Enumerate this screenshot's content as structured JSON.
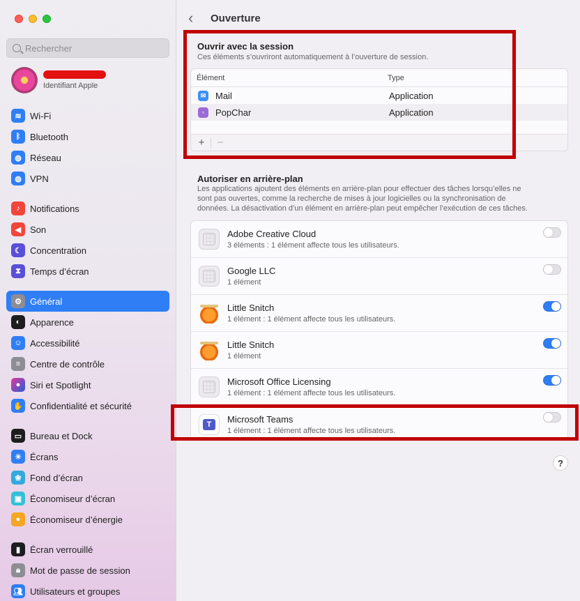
{
  "colors": {
    "accent": "#2f7ef5",
    "highlight": "#c00000"
  },
  "sidebar": {
    "search_placeholder": "Rechercher",
    "account_sub": "Identifiant Apple",
    "items": [
      {
        "label": "Wi-Fi",
        "icon": "wifi-icon"
      },
      {
        "label": "Bluetooth",
        "icon": "bluetooth-icon"
      },
      {
        "label": "Réseau",
        "icon": "globe-icon"
      },
      {
        "label": "VPN",
        "icon": "vpn-icon"
      },
      {
        "label": "Notifications",
        "icon": "bell-icon"
      },
      {
        "label": "Son",
        "icon": "speaker-icon"
      },
      {
        "label": "Concentration",
        "icon": "moon-icon"
      },
      {
        "label": "Temps d’écran",
        "icon": "hourglass-icon"
      },
      {
        "label": "Général",
        "icon": "gear-icon"
      },
      {
        "label": "Apparence",
        "icon": "appearance-icon"
      },
      {
        "label": "Accessibilité",
        "icon": "accessibility-icon"
      },
      {
        "label": "Centre de contrôle",
        "icon": "control-center-icon"
      },
      {
        "label": "Siri et Spotlight",
        "icon": "siri-icon"
      },
      {
        "label": "Confidentialité et sécurité",
        "icon": "hand-icon"
      },
      {
        "label": "Bureau et Dock",
        "icon": "dock-icon"
      },
      {
        "label": "Écrans",
        "icon": "display-icon"
      },
      {
        "label": "Fond d’écran",
        "icon": "wallpaper-icon"
      },
      {
        "label": "Économiseur d’écran",
        "icon": "screensaver-icon"
      },
      {
        "label": "Économiseur d’énergie",
        "icon": "energy-icon"
      },
      {
        "label": "Écran verrouillé",
        "icon": "lock-icon"
      },
      {
        "label": "Mot de passe de session",
        "icon": "password-icon"
      },
      {
        "label": "Utilisateurs et groupes",
        "icon": "users-icon"
      }
    ]
  },
  "main": {
    "title": "Ouverture",
    "session": {
      "title": "Ouvrir avec la session",
      "desc": "Ces éléments s’ouvriront automatiquement à l’ouverture de session.",
      "col_element": "Élément",
      "col_type": "Type",
      "rows": [
        {
          "name": "Mail",
          "type": "Application"
        },
        {
          "name": "PopChar",
          "type": "Application"
        }
      ],
      "add": "+",
      "remove": "−"
    },
    "background": {
      "title": "Autoriser en arrière-plan",
      "desc1": "Les applications ajoutent des éléments en arrière-plan pour effectuer des tâches lorsqu’elles ne",
      "desc2": "sont pas ouvertes, comme la recherche de mises à jour logicielles ou la synchronisation de",
      "desc3": "données. La désactivation d’un élément en arrière-plan peut empêcher l’exécution de ces tâches.",
      "items": [
        {
          "name": "Adobe Creative Cloud",
          "sub": "3 éléments : 1 élément affecte tous les utilisateurs.",
          "enabled": false
        },
        {
          "name": "Google LLC",
          "sub": "1 élément",
          "enabled": false
        },
        {
          "name": "Little Snitch",
          "sub": "1 élément : 1 élément affecte tous les utilisateurs.",
          "enabled": true
        },
        {
          "name": "Little Snitch",
          "sub": "1 élément",
          "enabled": true
        },
        {
          "name": "Microsoft Office Licensing",
          "sub": "1 élément : 1 élément affecte tous les utilisateurs.",
          "enabled": true
        },
        {
          "name": "Microsoft Teams",
          "sub": "1 élément : 1 élément affecte tous les utilisateurs.",
          "enabled": false
        }
      ]
    },
    "help": "?"
  }
}
